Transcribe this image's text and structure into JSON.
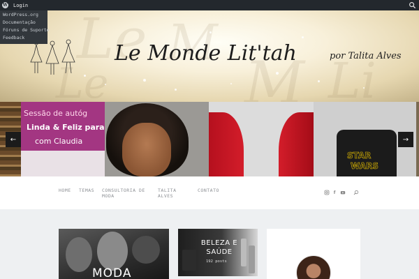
{
  "adminbar": {
    "wp_logo": "W",
    "login_label": "Login",
    "search_icon": "search-icon",
    "wp_menu": [
      "WordPress.org",
      "Documentação",
      "Fóruns de Suporte",
      "Feedback"
    ]
  },
  "header": {
    "site_title": "Le Monde Lit'tah",
    "tagline": "por Talita Alves",
    "illustration": "three-ladies-sketch"
  },
  "slider": {
    "slide1": {
      "line1": "Sessão de autóg",
      "line2": "Linda & Feliz para",
      "line3": "com Claudia"
    },
    "slide4": {
      "pillow_line1": "STAR",
      "pillow_line2": "WARS"
    },
    "prev_label": "←",
    "next_label": "→"
  },
  "nav": {
    "items": [
      "HOME",
      "TEMAS",
      "CONSULTORIA DE MODA",
      "TALITA ALVES",
      "CONTATO"
    ],
    "social": [
      "instagram-icon",
      "facebook-icon",
      "youtube-icon",
      "search-icon"
    ]
  },
  "cards": {
    "moda_title": "MODA",
    "beleza_title": "BELEZA E SAÚDE",
    "beleza_sub": "192 posts"
  },
  "colors": {
    "adminbar": "#23282d",
    "dropdown": "#32373c",
    "nav_text": "#8c8f94",
    "content_bg": "#eef0f2"
  }
}
